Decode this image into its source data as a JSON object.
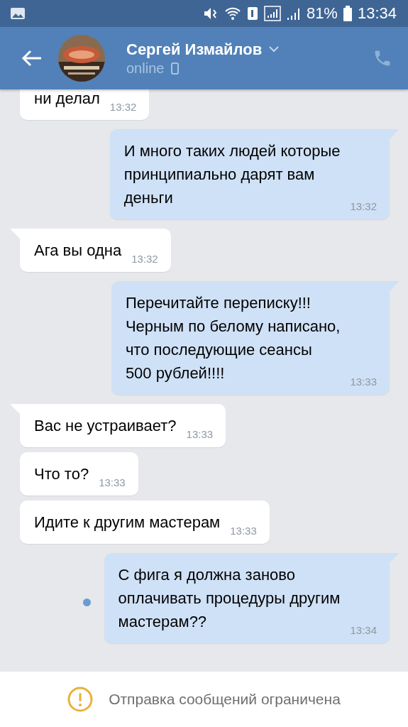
{
  "status_bar": {
    "battery": "81%",
    "time": "13:34"
  },
  "header": {
    "name": "Сергей Измайлов",
    "status": "online"
  },
  "messages": [
    {
      "kind": "incoming",
      "text": "ни делал",
      "time": "13:32",
      "unread": false
    },
    {
      "kind": "outgoing",
      "text": "И много таких людей которые\nпринципиально дарят вам\nденьги",
      "time": "13:32",
      "unread": false
    },
    {
      "kind": "incoming",
      "text": "Ага вы одна",
      "time": "13:32",
      "unread": false
    },
    {
      "kind": "outgoing",
      "text": "Перечитайте переписку!!!\nЧерным по белому написано,\nчто последующие сеансы\n500 рублей!!!!",
      "time": "13:33",
      "unread": false
    },
    {
      "kind": "incoming",
      "text": "Вас не устраивает?",
      "time": "13:33",
      "unread": false
    },
    {
      "kind": "incoming",
      "text": "Что то?",
      "time": "13:33",
      "unread": false
    },
    {
      "kind": "incoming",
      "text": "Идите к другим мастерам",
      "time": "13:33",
      "unread": false
    },
    {
      "kind": "outgoing",
      "text": "С фига я должна заново\nоплачивать процедуры другим\nмастерам??",
      "time": "13:34",
      "unread": true
    }
  ],
  "notice": {
    "text": "Отправка сообщений ограничена"
  }
}
